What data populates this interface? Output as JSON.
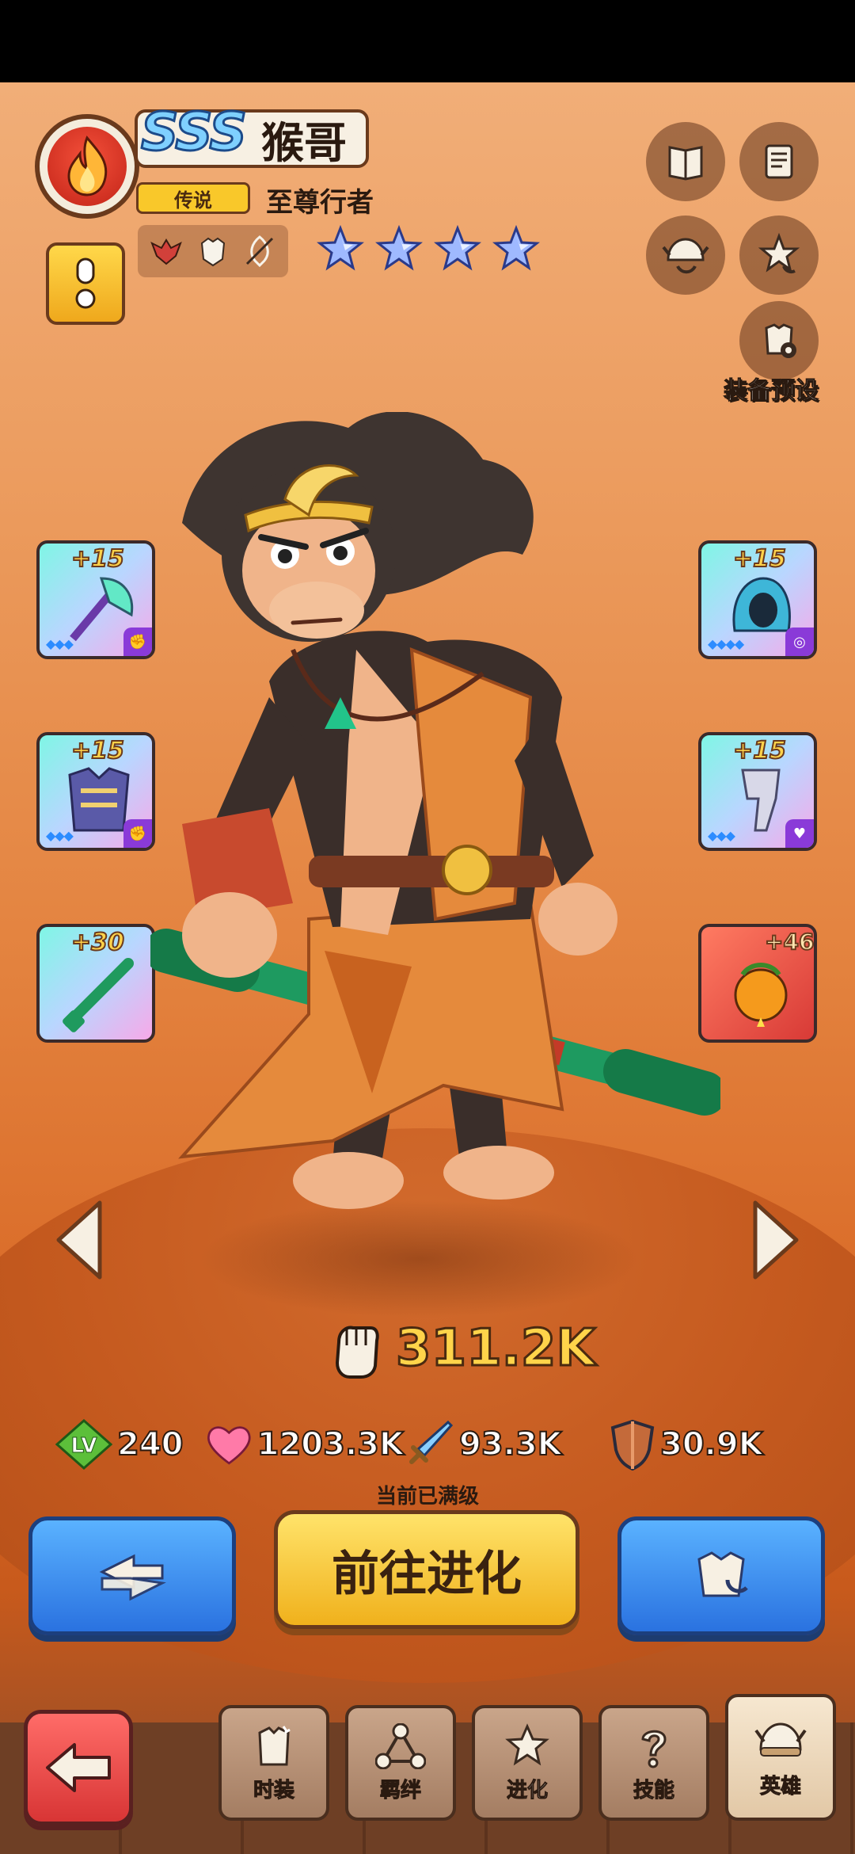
{
  "hero": {
    "grade": "SSS",
    "name": "猴哥",
    "rarity": "传说",
    "title": "至尊行者",
    "stars": 4,
    "power": "311.2K",
    "stats": {
      "level_label": "LV",
      "level": "240",
      "hp": "1203.3K",
      "attack": "93.3K",
      "defense": "30.9K"
    },
    "maxed_note": "当前已满级"
  },
  "icons": {
    "element": "fire-icon",
    "traits": [
      "winged-trait-icon",
      "armor-trait-icon",
      "leaf-trait-icon"
    ],
    "top_right": [
      "book-icon",
      "scroll-icon",
      "helmet-swap-icon",
      "star-swap-icon",
      "armor-gear-icon"
    ]
  },
  "preset_label": "装备预设",
  "equipment": {
    "left": [
      {
        "level": "+15",
        "gems": "◆◆◆",
        "kind": "weapon-axe"
      },
      {
        "level": "+15",
        "gems": "◆◆◆",
        "kind": "armor-chest"
      },
      {
        "level": "+30",
        "gems": "",
        "kind": "staff-weapon"
      }
    ],
    "right": [
      {
        "level": "+15",
        "gems": "◆◆◆◆",
        "kind": "hood-helmet"
      },
      {
        "level": "+15",
        "gems": "◆◆◆",
        "kind": "leg-armor"
      },
      {
        "level": "+46",
        "gems": "",
        "kind": "golden-fruit"
      }
    ]
  },
  "actions": {
    "evolve_label": "前往进化"
  },
  "tabs": [
    {
      "label": "时装",
      "icon": "outfit-icon"
    },
    {
      "label": "羁绊",
      "icon": "bond-icon"
    },
    {
      "label": "进化",
      "icon": "evolve-star-icon"
    },
    {
      "label": "技能",
      "icon": "skill-icon"
    },
    {
      "label": "英雄",
      "icon": "hero-helmet-icon",
      "active": true
    }
  ],
  "colors": {
    "accent_yellow": "#ffd44a",
    "button_blue": "#2a72e0",
    "back_red": "#d83535"
  }
}
